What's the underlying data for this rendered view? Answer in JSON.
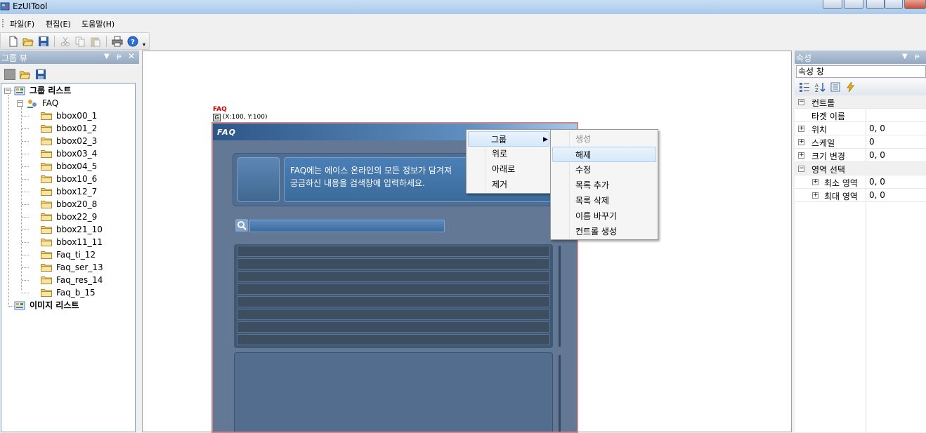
{
  "window": {
    "title": "EzUITool"
  },
  "menu": {
    "items": [
      "파일(F)",
      "편집(E)",
      "도움말(H)"
    ]
  },
  "toolbar": {
    "icons": [
      "new-file-icon",
      "open-folder-icon",
      "save-icon",
      "cut-icon",
      "copy-icon",
      "paste-icon",
      "print-icon",
      "help-icon"
    ]
  },
  "group_view": {
    "title": "그룹 뷰",
    "root_label": "그룹 리스트",
    "group_label": "FAQ",
    "items": [
      "bbox00_1",
      "bbox01_2",
      "bbox02_3",
      "bbox03_4",
      "bbox04_5",
      "bbox10_6",
      "bbox12_7",
      "bbox20_8",
      "bbox22_9",
      "bbox21_10",
      "bbox11_11",
      "Faq_ti_12",
      "Faq_ser_13",
      "Faq_res_14",
      "Faq_b_15"
    ],
    "image_list_label": "이미지 리스트"
  },
  "canvas": {
    "faq_tag": "FAQ",
    "coord_icon": "G",
    "coord_text": "(X:100, Y:100)",
    "faq_logo": "FAQ",
    "faq_message_line1": "FAQ에는 에이스 온라인의 모든 정보가 담겨져",
    "faq_message_line2": "궁금하신 내용을 검색창에 입력하세요."
  },
  "context_menu": {
    "items": [
      "그룹",
      "위로",
      "아래로",
      "제거"
    ],
    "submenu": [
      "생성",
      "해제",
      "수정",
      "목록 추가",
      "목록 삭제",
      "이름 바꾸기",
      "컨트롤 생성"
    ]
  },
  "properties": {
    "title": "속성",
    "selector": "속성 창",
    "rows": [
      {
        "name": "컨트롤",
        "value": ""
      },
      {
        "name": "타겟 이름",
        "value": ""
      },
      {
        "name": "위치",
        "value": "0, 0"
      },
      {
        "name": "스케일",
        "value": "0"
      },
      {
        "name": "크기 변경",
        "value": "0, 0"
      },
      {
        "name": "영역 선택",
        "value": ""
      },
      {
        "name": "최소 영역",
        "value": "0, 0"
      },
      {
        "name": "최대 영역",
        "value": "0, 0"
      }
    ]
  }
}
